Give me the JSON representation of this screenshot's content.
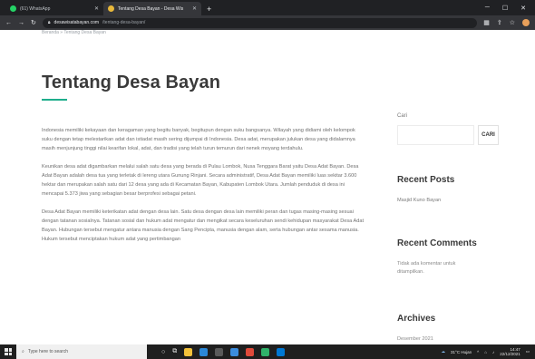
{
  "browser": {
    "tabs": [
      {
        "title": "(61) WhatsApp",
        "active": false,
        "favicon_color": "#25d366"
      },
      {
        "title": "Tentang Desa Bayan - Desa Wis",
        "active": true,
        "favicon_color": "#e8b83a"
      }
    ],
    "new_tab_label": "+",
    "address": {
      "domain": "desawisatabayan.com",
      "path": "/tentang-desa-bayan/"
    }
  },
  "page": {
    "breadcrumb": "Beranda » Tentang Desa Bayan",
    "title": "Tentang Desa Bayan",
    "accent_color": "#1eae8c",
    "paragraphs": [
      "Indonesia memiliki kekayaan dan keragaman yang begitu banyak, begitupun dengan suku bangsanya. Wilayah yang didiami oleh kelompok suku dengan tetap melestarikan adat dan istiadat masih sering dijumpai di Indonesia. Desa adat, merupakan julukan desa yang didalamnya masih menjunjung tinggi nilai kearifan lokal, adat, dan tradisi yang telah turun temurun dari nenek moyang terdahulu.",
      "Keunikan desa adat digambarkan melalui salah satu desa yang berada di Pulau Lombok, Nusa Tenggara Barat yaitu Desa Adat Bayan. Desa Adat Bayan adalah desa tua yang terletak di lereng utara Gunung Rinjani. Secara administratif, Desa Adat Bayan memiliki luas sekitar 3.600 hektar dan merupakan salah satu dari 12 desa yang ada di Kecamatan Bayan, Kabupaten Lombok Utara. Jumlah penduduk di desa ini mencapai 5.373 jiwa yang sebagian besar berprofesi sebagai petani.",
      "Desa Adat Bayan memiliki keterikatan adat dengan desa lain. Satu desa dengan desa lain memiliki peran dan tugas masing-masing sesuai dengan tatanan sosialnya. Tatanan sosial dan hukum adat mengatur dan mengikat secara keseluruhan sendi kehidupan masyarakat Desa Adat Bayan. Hubungan tersebut mengatur antara manusia dengan Sang Pencipta, manusia dengan alam, serta hubungan antar sesama manusia. Hukum tersebut menciptakan hukum adat yang pertimbangan"
    ]
  },
  "sidebar": {
    "search_label": "Cari",
    "search_placeholder": "",
    "search_button": "CARI",
    "recent_posts_title": "Recent Posts",
    "recent_posts": [
      "Masjid Kuno Bayan"
    ],
    "recent_comments_title": "Recent Comments",
    "recent_comments_empty": "Tidak ada komentar untuk ditampilkan.",
    "archives_title": "Archives",
    "archives": [
      "Desember 2021"
    ]
  },
  "taskbar": {
    "search_placeholder": "Type here to search",
    "weather": "31°C Hujan",
    "time": "14:47",
    "date": "22/12/2021",
    "app_colors": [
      "#f3c13a",
      "#2b88d8",
      "#5a5a5a",
      "#3c8dde",
      "#e04a3a",
      "#2fb26a",
      "#0078d4"
    ]
  }
}
